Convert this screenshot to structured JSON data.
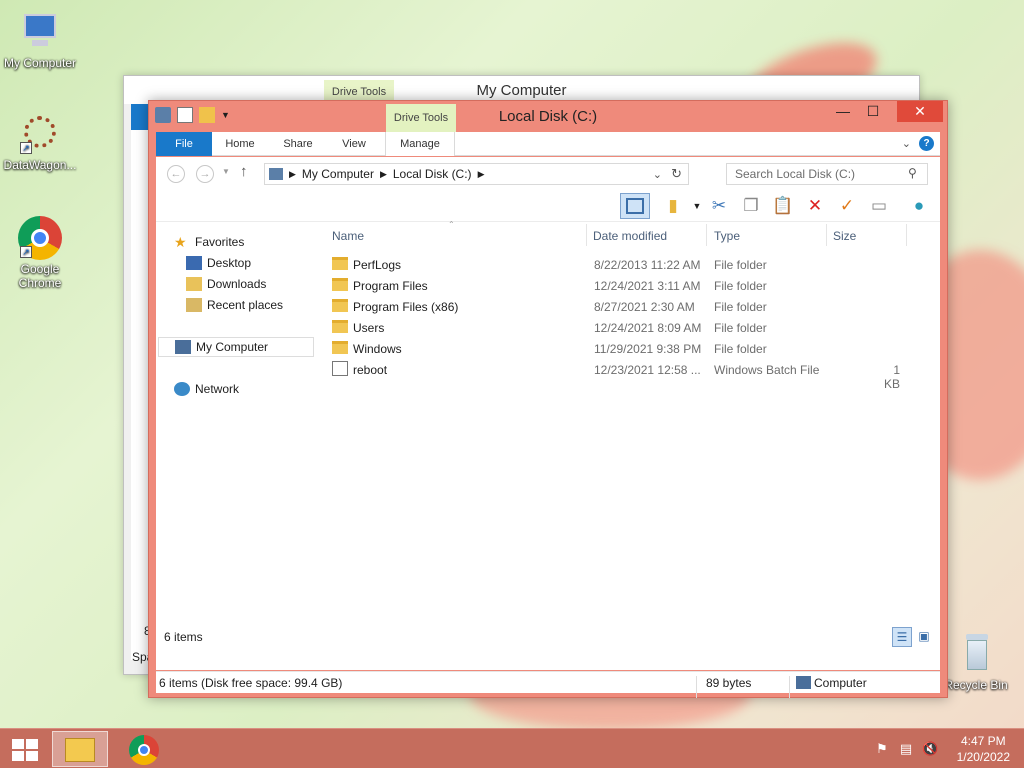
{
  "desktop": {
    "icons": [
      {
        "label": "My Computer"
      },
      {
        "label": "DataWagon..."
      },
      {
        "label": "Google Chrome"
      },
      {
        "label": "Recycle Bin"
      }
    ]
  },
  "back_window": {
    "title": "My Computer",
    "drive_tools": "Drive Tools",
    "left_fragment_1": "8",
    "left_fragment_2": "Spa"
  },
  "window": {
    "title": "Local Disk (C:)",
    "drive_tools": "Drive Tools",
    "controls": {
      "minimize": "—",
      "maximize": "☐",
      "close": "✕"
    },
    "tabs": {
      "file": "File",
      "home": "Home",
      "share": "Share",
      "view": "View",
      "manage": "Manage"
    },
    "help": "?",
    "address": {
      "crumbs": [
        "My Computer",
        "Local Disk (C:)"
      ]
    },
    "search": {
      "placeholder": "Search Local Disk (C:)"
    },
    "nav": {
      "favorites": "Favorites",
      "desktop": "Desktop",
      "downloads": "Downloads",
      "recent": "Recent places",
      "my_computer": "My Computer",
      "network": "Network"
    },
    "columns": {
      "name": "Name",
      "date": "Date modified",
      "type": "Type",
      "size": "Size"
    },
    "files": [
      {
        "name": "PerfLogs",
        "date": "8/22/2013 11:22 AM",
        "type": "File folder",
        "size": "",
        "icon": "folder-icon"
      },
      {
        "name": "Program Files",
        "date": "12/24/2021 3:11 AM",
        "type": "File folder",
        "size": "",
        "icon": "folder-icon"
      },
      {
        "name": "Program Files (x86)",
        "date": "8/27/2021 2:30 AM",
        "type": "File folder",
        "size": "",
        "icon": "folder-icon"
      },
      {
        "name": "Users",
        "date": "12/24/2021 8:09 AM",
        "type": "File folder",
        "size": "",
        "icon": "folder-icon"
      },
      {
        "name": "Windows",
        "date": "11/29/2021 9:38 PM",
        "type": "File folder",
        "size": "",
        "icon": "folder-icon"
      },
      {
        "name": "reboot",
        "date": "12/23/2021 12:58 ...",
        "type": "Windows Batch File",
        "size": "1 KB",
        "icon": "batch-file-icon"
      }
    ],
    "item_count": "6 items",
    "status": {
      "left": "6 items (Disk free space: 99.4 GB)",
      "middle": "89 bytes",
      "right": "Computer"
    }
  },
  "taskbar": {
    "time": "4:47 PM",
    "date": "1/20/2022"
  },
  "colors": {
    "accent": "#ef8a7b",
    "file_tab": "#1979ca",
    "taskbar": "#c56d5d"
  }
}
